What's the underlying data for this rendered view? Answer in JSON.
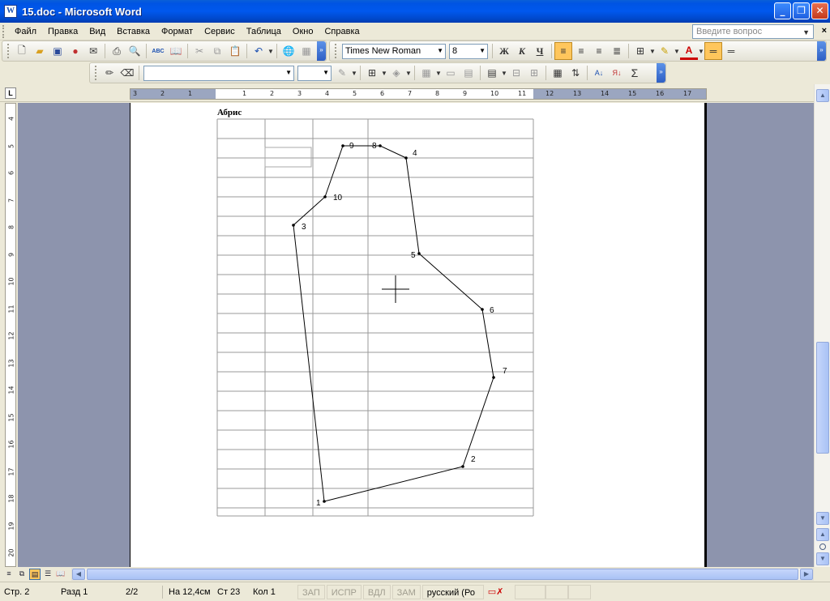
{
  "window": {
    "title": "15.doc - Microsoft Word",
    "app_icon": "W"
  },
  "menu": [
    "Файл",
    "Правка",
    "Вид",
    "Вставка",
    "Формат",
    "Сервис",
    "Таблица",
    "Окно",
    "Справка"
  ],
  "ask": {
    "placeholder": "Введите вопрос"
  },
  "formatting": {
    "font_name": "Times New Roman",
    "font_size": "8",
    "bold": "Ж",
    "italic": "К",
    "underline": "Ч"
  },
  "icons": {
    "spell": "ABC",
    "font_color": "A",
    "sum": "Σ",
    "sort": "А↓"
  },
  "ruler": {
    "h_ticks": [
      "3",
      "2",
      "1",
      "1",
      "2",
      "3",
      "4",
      "5",
      "6",
      "7",
      "8",
      "9",
      "10",
      "11",
      "12",
      "13",
      "14",
      "15",
      "16",
      "17"
    ],
    "v_ticks": [
      "4",
      "5",
      "6",
      "7",
      "8",
      "9",
      "10",
      "11",
      "12",
      "13",
      "14",
      "15",
      "16",
      "17",
      "18",
      "19",
      "20"
    ]
  },
  "document": {
    "heading": "Абрис",
    "point_labels": [
      {
        "id": "point-9",
        "text": "9"
      },
      {
        "id": "point-8",
        "text": "8"
      },
      {
        "id": "point-4",
        "text": "4"
      },
      {
        "id": "point-10",
        "text": "10"
      },
      {
        "id": "point-3",
        "text": "3"
      },
      {
        "id": "point-5",
        "text": "5"
      },
      {
        "id": "point-6",
        "text": "6"
      },
      {
        "id": "point-7",
        "text": "7"
      },
      {
        "id": "point-2",
        "text": "2"
      },
      {
        "id": "point-1",
        "text": "1"
      }
    ]
  },
  "status": {
    "page": "Стр. 2",
    "section": "Разд 1",
    "pages": "2/2",
    "position": "На 12,4см",
    "line": "Ст 23",
    "column": "Кол 1",
    "rec": "ЗАП",
    "track": "ИСПР",
    "ext": "ВДЛ",
    "ovr": "ЗАМ",
    "language": "русский (Ро"
  }
}
